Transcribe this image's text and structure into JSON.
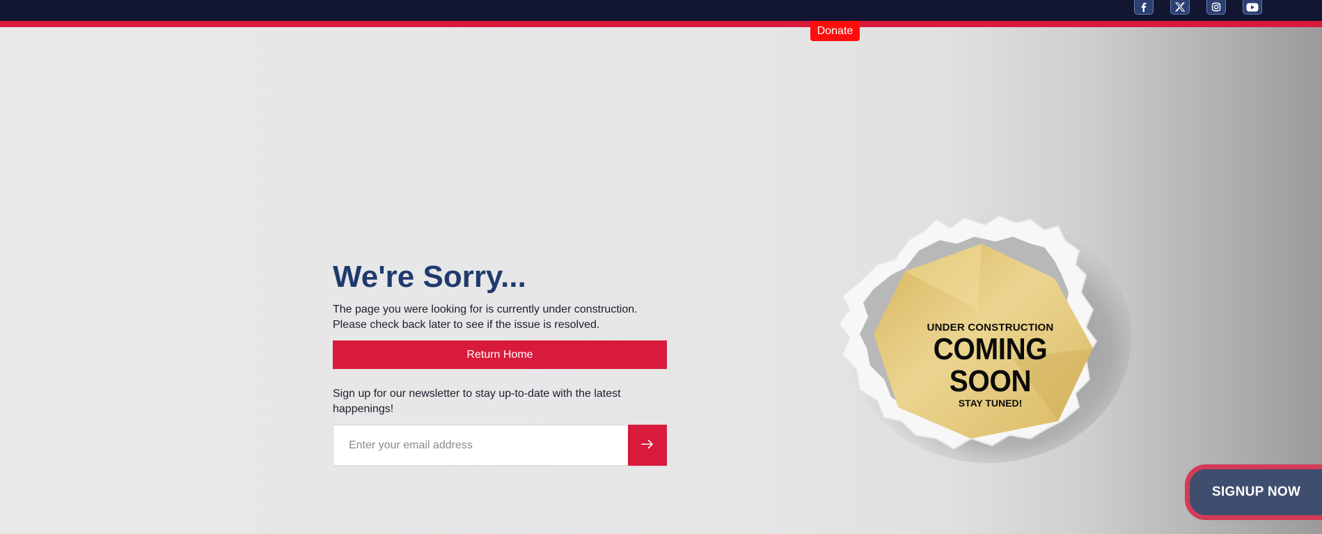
{
  "header": {
    "social": [
      {
        "icon": "facebook-icon"
      },
      {
        "icon": "x-icon"
      },
      {
        "icon": "instagram-icon"
      },
      {
        "icon": "youtube-icon"
      }
    ],
    "donate_label": "Donate"
  },
  "main": {
    "title": "We're Sorry...",
    "description": "The page you were looking for is currently under construction. Please check back later to see if the issue is resolved.",
    "return_label": "Return Home",
    "newsletter_text": "Sign up for our newsletter to stay up-to-date with the latest happenings!",
    "email_placeholder": "Enter your email address"
  },
  "graphic": {
    "top_text": "UNDER CONSTRUCTION",
    "main_text": "COMING SOON",
    "bottom_text": "STAY TUNED!"
  },
  "signup_label": "SIGNUP NOW",
  "colors": {
    "navy": "#121631",
    "accent_red": "#d81a3c",
    "title_blue": "#1f3a6e",
    "donate_red": "#ff0d0d",
    "badge_gold": "#e2c36a"
  }
}
